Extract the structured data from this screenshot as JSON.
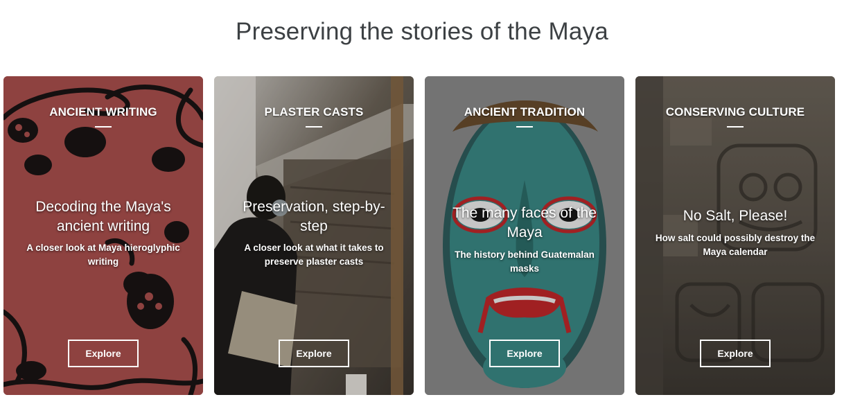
{
  "page": {
    "title": "Preserving the stories of the Maya"
  },
  "cards": [
    {
      "category": "ANCIENT WRITING",
      "headline": "Decoding the Maya's ancient writing",
      "subtitle": "A closer look at Maya hieroglyphic writing",
      "button": "Explore",
      "image_subject": "red-glyph-pattern"
    },
    {
      "category": "PLASTER CASTS",
      "headline": "Preservation, step-by-step",
      "subtitle": "A closer look at what it takes to preserve plaster casts",
      "button": "Explore",
      "image_subject": "conservator-working-on-cast"
    },
    {
      "category": "ANCIENT TRADITION",
      "headline": "The many faces of the Maya",
      "subtitle": "The history behind Guatemalan masks",
      "button": "Explore",
      "image_subject": "turquoise-mask"
    },
    {
      "category": "CONSERVING CULTURE",
      "headline": "No Salt, Please!",
      "subtitle": "How salt could possibly destroy the Maya calendar",
      "button": "Explore",
      "image_subject": "carved-stone-relief"
    }
  ],
  "colors": {
    "title": "#3c4043",
    "card1": "#8e4240",
    "card2": "#6f6e6a",
    "card3": "#8d8d8d",
    "card4": "#5a544c"
  }
}
